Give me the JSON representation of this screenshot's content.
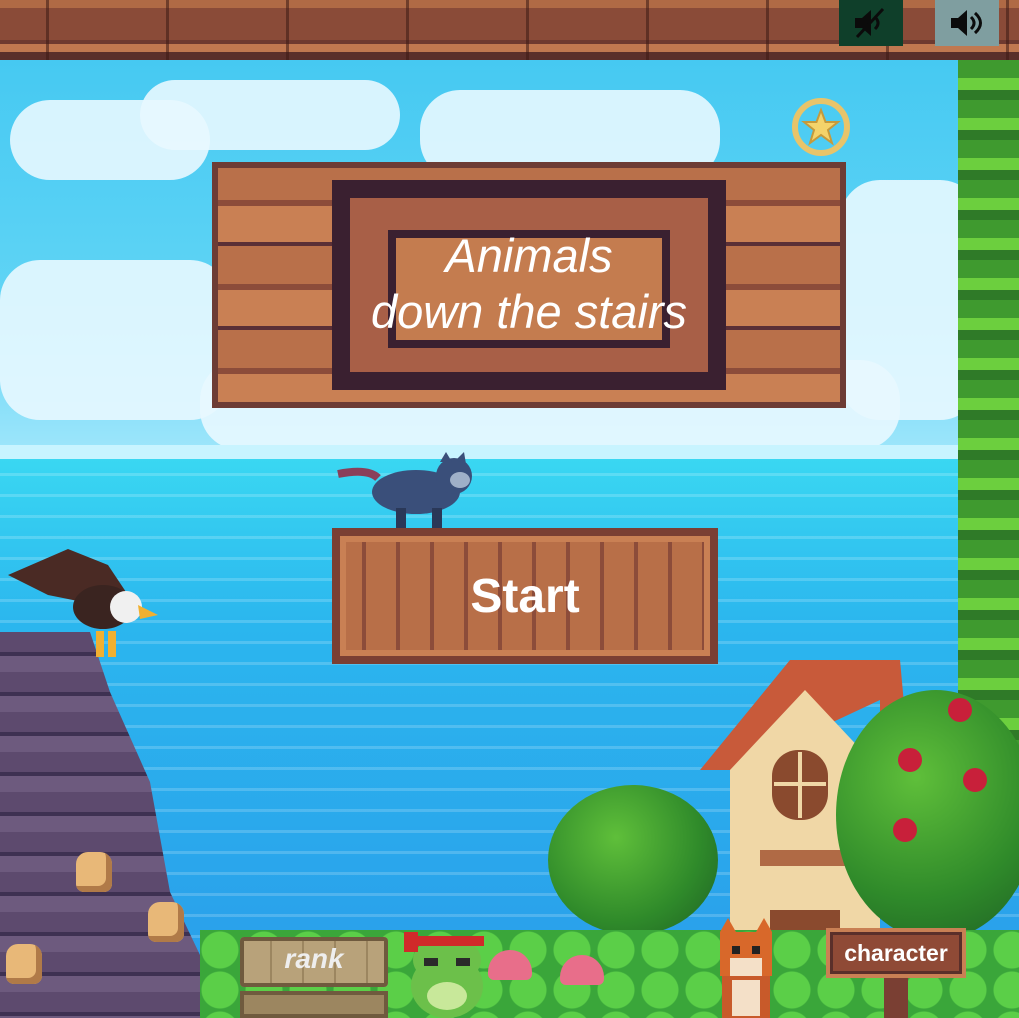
{
  "game": {
    "title_line1": "Animals",
    "title_line2": "down the stairs",
    "start_label": "Start",
    "rank_label": "rank",
    "character_label": "character"
  },
  "toolbar": {
    "mute_icon": "speaker-muted-icon",
    "volume_icon": "speaker-volume-icon"
  },
  "colors": {
    "wood": "#b9704a",
    "wood_dark": "#5a2f36",
    "sky": "#46c9f2",
    "sea": "#2a9cea",
    "mute_bg": "#0f3f2a",
    "volume_bg": "#7f9ea0"
  }
}
